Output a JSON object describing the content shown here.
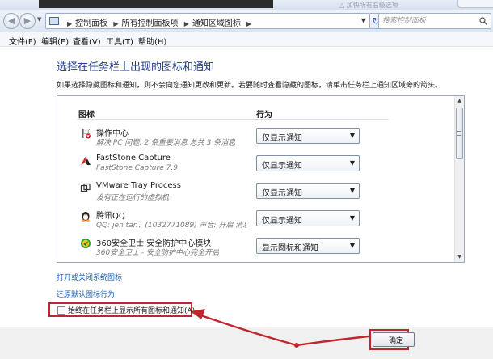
{
  "titlebar": {
    "faint_text": "△ 加快所有右级选项"
  },
  "navigation": {
    "back_glyph": "◀",
    "forward_glyph": "▶",
    "breadcrumbs": [
      "控制面板",
      "所有控制面板项",
      "通知区域图标"
    ],
    "separator": "▶",
    "search_placeholder": "搜索控制面板",
    "refresh_glyph": "↻"
  },
  "menu": [
    {
      "name": "file",
      "label": "文件(F)"
    },
    {
      "name": "edit",
      "label": "编辑(E)"
    },
    {
      "name": "view",
      "label": "查看(V)"
    },
    {
      "name": "tools",
      "label": "工具(T)"
    },
    {
      "name": "help",
      "label": "帮助(H)"
    }
  ],
  "page": {
    "title": "选择在任务栏上出现的图标和通知",
    "description": "如果选择隐藏图标和通知，则不会向您通知更改和更新。若要随时查看隐藏的图标，请单击任务栏上通知区域旁的箭头。"
  },
  "table": {
    "col_icon": "图标",
    "col_behavior": "行为",
    "rows": [
      {
        "icon": "action-center-flag-icon",
        "name": "操作中心",
        "sub": "解决 PC 问题: 2 条重要消息 总共 3 条消息",
        "behavior": "仅显示通知"
      },
      {
        "icon": "faststone-capture-icon",
        "name": "FastStone Capture",
        "sub": "FastStone Capture 7.9",
        "behavior": "仅显示通知"
      },
      {
        "icon": "vmware-tray-icon",
        "name": "VMware Tray Process",
        "sub": "没有正在运行的虚拟机",
        "behavior": "仅显示通知"
      },
      {
        "icon": "qq-penguin-icon",
        "name": "腾讯QQ",
        "sub": "QQ: jen tan、(1032771089) 声音: 开启 消息提...",
        "behavior": "仅显示通知"
      },
      {
        "icon": "360-safe-guard-icon",
        "name": "360安全卫士 安全防护中心模块",
        "sub": "360安全卫士 - 安全防护中心完全开启",
        "behavior": "显示图标和通知"
      }
    ]
  },
  "links": {
    "toggle_system_icons": "打开或关闭系统图标",
    "restore_defaults": "还原默认图标行为"
  },
  "always_show": {
    "label": "始终在任务栏上显示所有图标和通知(A)",
    "checked": false
  },
  "footer": {
    "ok_label": "确定"
  },
  "colors": {
    "annotation_red": "#c0262c",
    "link_blue": "#1a5fb4",
    "title_blue": "#1e3a8a"
  }
}
